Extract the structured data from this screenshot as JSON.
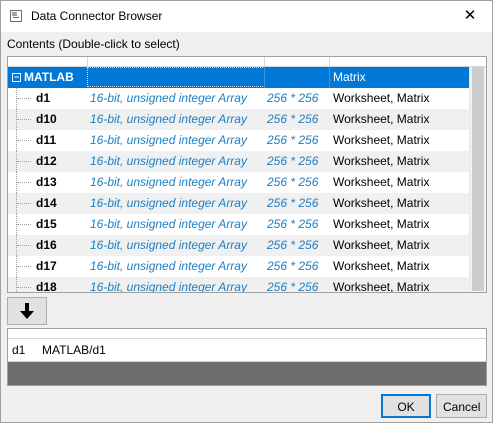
{
  "window": {
    "title": "Data Connector Browser",
    "close_glyph": "✕"
  },
  "contents_label": "Contents (Double-click to select)",
  "tree": {
    "root": {
      "expander": "−",
      "name": "MATLAB",
      "kind": "Matrix"
    },
    "children": [
      {
        "name": "d1",
        "type": "16-bit, unsigned integer Array",
        "size": "256 * 256",
        "kind": "Worksheet, Matrix"
      },
      {
        "name": "d10",
        "type": "16-bit, unsigned integer Array",
        "size": "256 * 256",
        "kind": "Worksheet, Matrix"
      },
      {
        "name": "d11",
        "type": "16-bit, unsigned integer Array",
        "size": "256 * 256",
        "kind": "Worksheet, Matrix"
      },
      {
        "name": "d12",
        "type": "16-bit, unsigned integer Array",
        "size": "256 * 256",
        "kind": "Worksheet, Matrix"
      },
      {
        "name": "d13",
        "type": "16-bit, unsigned integer Array",
        "size": "256 * 256",
        "kind": "Worksheet, Matrix"
      },
      {
        "name": "d14",
        "type": "16-bit, unsigned integer Array",
        "size": "256 * 256",
        "kind": "Worksheet, Matrix"
      },
      {
        "name": "d15",
        "type": "16-bit, unsigned integer Array",
        "size": "256 * 256",
        "kind": "Worksheet, Matrix"
      },
      {
        "name": "d16",
        "type": "16-bit, unsigned integer Array",
        "size": "256 * 256",
        "kind": "Worksheet, Matrix"
      },
      {
        "name": "d17",
        "type": "16-bit, unsigned integer Array",
        "size": "256 * 256",
        "kind": "Worksheet, Matrix"
      },
      {
        "name": "d18",
        "type": "16-bit, unsigned integer Array",
        "size": "256 * 256",
        "kind": "Worksheet, Matrix"
      }
    ]
  },
  "selection": {
    "name": "d1",
    "path": "MATLAB/d1"
  },
  "buttons": {
    "ok": "OK",
    "cancel": "Cancel"
  },
  "icons": {
    "app": "data-connector-app-icon",
    "close": "close-icon",
    "down": "down-arrow-icon"
  },
  "colors": {
    "selection": "#0078d7",
    "type_text": "#1a7fc2",
    "panel_fill": "#6e6e6e"
  }
}
